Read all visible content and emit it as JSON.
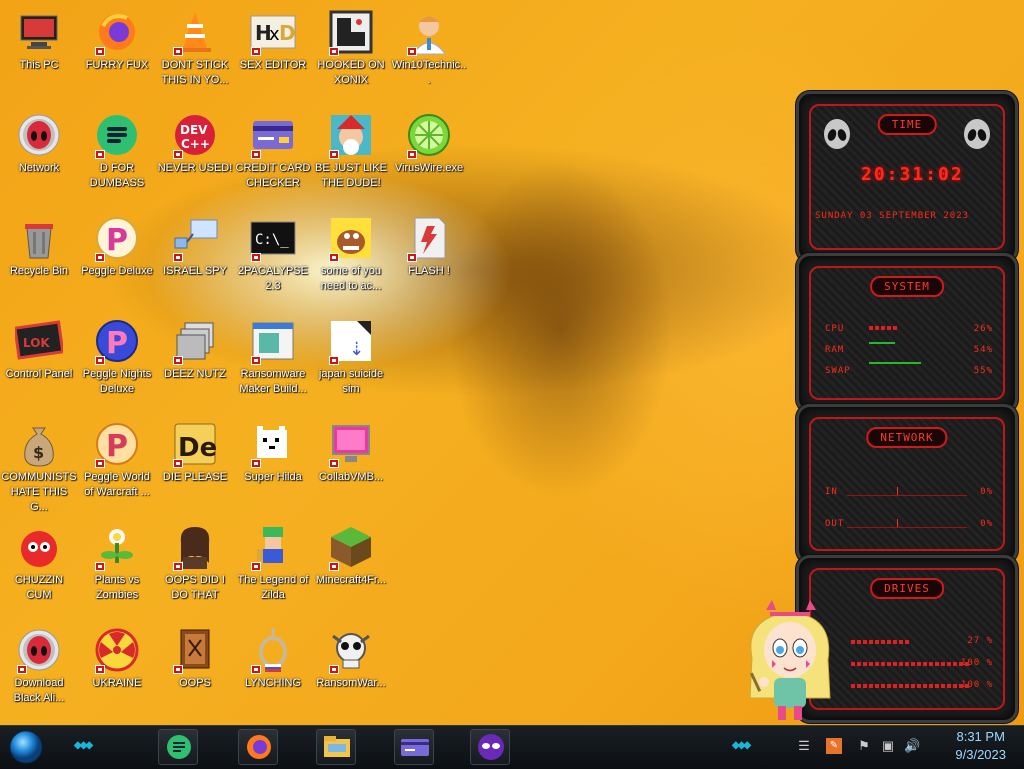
{
  "desktop": {
    "icons": [
      {
        "label": "This PC",
        "icon": "pc-icon",
        "col": 0,
        "row": 0
      },
      {
        "label": "FURRY FUX",
        "icon": "firefox-icon",
        "col": 1,
        "row": 0
      },
      {
        "label": "DONT STICK THIS IN YO...",
        "icon": "vlc-cone-icon",
        "col": 2,
        "row": 0
      },
      {
        "label": "SEX EDITOR",
        "icon": "hxd-editor-icon",
        "col": 3,
        "row": 0
      },
      {
        "label": "HOOKED ON XONIX",
        "icon": "xonix-game-icon",
        "col": 4,
        "row": 0
      },
      {
        "label": "Win10Technic...",
        "icon": "doctor-avatar-icon",
        "col": 5,
        "row": 0
      },
      {
        "label": "Network",
        "icon": "alien-network-icon",
        "col": 0,
        "row": 1
      },
      {
        "label": "D FOR DUMBASS",
        "icon": "discord-green-icon",
        "col": 1,
        "row": 1
      },
      {
        "label": "NEVER USED!",
        "icon": "devcpp-icon",
        "col": 2,
        "row": 1
      },
      {
        "label": "CREDIT CARD CHECKER",
        "icon": "credit-card-icon",
        "col": 3,
        "row": 1
      },
      {
        "label": "BE JUST LIKE THE DUDE!",
        "icon": "santa-elf-icon",
        "col": 4,
        "row": 1
      },
      {
        "label": "VirusWire.exe",
        "icon": "lime-wire-icon",
        "col": 5,
        "row": 1
      },
      {
        "label": "Recycle Bin",
        "icon": "recycle-bin-icon",
        "col": 0,
        "row": 2
      },
      {
        "label": "Peggle Deluxe",
        "icon": "peggle-icon",
        "col": 1,
        "row": 2
      },
      {
        "label": "ISRAEL SPY",
        "icon": "network-spy-icon",
        "col": 2,
        "row": 2
      },
      {
        "label": "2PACALYPSE 2.3",
        "icon": "terminal-icon",
        "col": 3,
        "row": 2
      },
      {
        "label": "some of you need to ac...",
        "icon": "cartoon-dog-icon",
        "col": 4,
        "row": 2
      },
      {
        "label": "FLASH !",
        "icon": "flash-document-icon",
        "col": 5,
        "row": 2
      },
      {
        "label": "Control Panel",
        "icon": "control-panel-icon",
        "col": 0,
        "row": 3
      },
      {
        "label": "Peggle Nights Deluxe",
        "icon": "peggle-nights-icon",
        "col": 1,
        "row": 3
      },
      {
        "label": "DEEZ NUTZ",
        "icon": "stacked-windows-icon",
        "col": 2,
        "row": 3
      },
      {
        "label": "Ransomware Maker Build...",
        "icon": "app-window-icon",
        "col": 3,
        "row": 3
      },
      {
        "label": "japan suicide sim",
        "icon": "japan-sim-icon",
        "col": 4,
        "row": 3
      },
      {
        "label": "COMMUNISTS HATE THIS G...",
        "icon": "money-bag-icon",
        "col": 0,
        "row": 4
      },
      {
        "label": "Peggle World of Warcraft ...",
        "icon": "peggle-wow-icon",
        "col": 1,
        "row": 4
      },
      {
        "label": "DIE PLEASE",
        "icon": "de-icon",
        "col": 2,
        "row": 4
      },
      {
        "label": "Super Hilda",
        "icon": "pixel-cat-icon",
        "col": 3,
        "row": 4
      },
      {
        "label": "CollabVMB...",
        "icon": "monitor-app-icon",
        "col": 4,
        "row": 4
      },
      {
        "label": "CHUZZIN CUM",
        "icon": "chuzzle-icon",
        "col": 0,
        "row": 5
      },
      {
        "label": "Plants vs Zombies",
        "icon": "plants-zombies-icon",
        "col": 1,
        "row": 5
      },
      {
        "label": "OOPS DID I DO THAT",
        "icon": "portrait-icon",
        "col": 2,
        "row": 5
      },
      {
        "label": "The Legend of Zilda",
        "icon": "pixel-hero-icon",
        "col": 3,
        "row": 5
      },
      {
        "label": "Minecraft4Fr...",
        "icon": "minecraft-block-icon",
        "col": 4,
        "row": 5
      },
      {
        "label": "Download Black Ali...",
        "icon": "alien-download-icon",
        "col": 0,
        "row": 6
      },
      {
        "label": "UKRAINE",
        "icon": "radiation-icon",
        "col": 1,
        "row": 6
      },
      {
        "label": "OOPS",
        "icon": "book-icon",
        "col": 2,
        "row": 6
      },
      {
        "label": "LYNCHING",
        "icon": "noose-icon",
        "col": 3,
        "row": 6
      },
      {
        "label": "RansomWar...",
        "icon": "skull-icon",
        "col": 4,
        "row": 6
      }
    ]
  },
  "widgets": {
    "time": {
      "title": "TIME",
      "clock": "20:31:02",
      "date": "SUNDAY 03 SEPTEMBER 2023"
    },
    "system": {
      "title": "SYSTEM",
      "rows": [
        {
          "label": "CPU",
          "value": "26%",
          "level": 0.26
        },
        {
          "label": "RAM",
          "value": "54%",
          "level": 0.54
        },
        {
          "label": "SWAP",
          "value": "55%",
          "level": 0.55
        }
      ]
    },
    "network": {
      "title": "NETWORK",
      "rows": [
        {
          "label": "IN",
          "value": "0%"
        },
        {
          "label": "OUT",
          "value": "0%"
        }
      ]
    },
    "drives": {
      "title": "DRIVES",
      "rows": [
        {
          "value": "27 %",
          "level": 0.27
        },
        {
          "value": "100 %",
          "level": 1.0
        },
        {
          "value": "100 %",
          "level": 1.0
        }
      ]
    }
  },
  "taskbar": {
    "pinned": [
      {
        "name": "start-orb-icon"
      },
      {
        "name": "discord-green-icon"
      },
      {
        "name": "firefox-icon"
      },
      {
        "name": "file-explorer-icon"
      },
      {
        "name": "credit-card-icon"
      },
      {
        "name": "mask-app-icon"
      }
    ],
    "clock": {
      "time": "8:31 PM",
      "date": "9/3/2023"
    }
  },
  "colors": {
    "accent": "#ff2a1a",
    "taskbar": "#12171b",
    "clockText": "#9fd8ff"
  }
}
